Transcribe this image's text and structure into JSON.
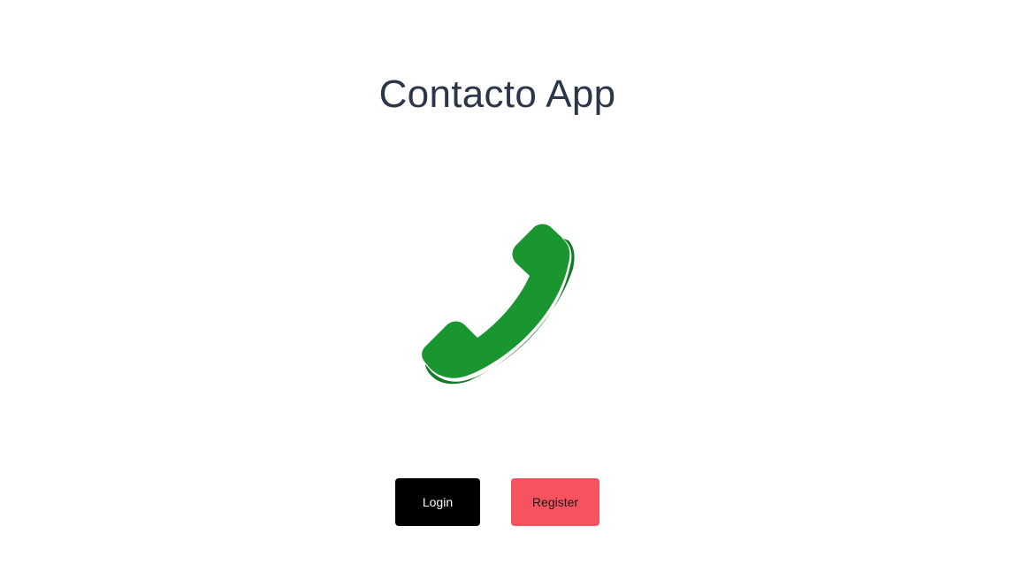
{
  "app": {
    "title": "Contacto App"
  },
  "hero": {
    "icon": "phone-icon",
    "icon_color": "#1a9630",
    "icon_shadow_color": "#137a25"
  },
  "actions": {
    "login_label": "Login",
    "register_label": "Register",
    "login_color": "#000000",
    "register_color": "#f7535f"
  }
}
